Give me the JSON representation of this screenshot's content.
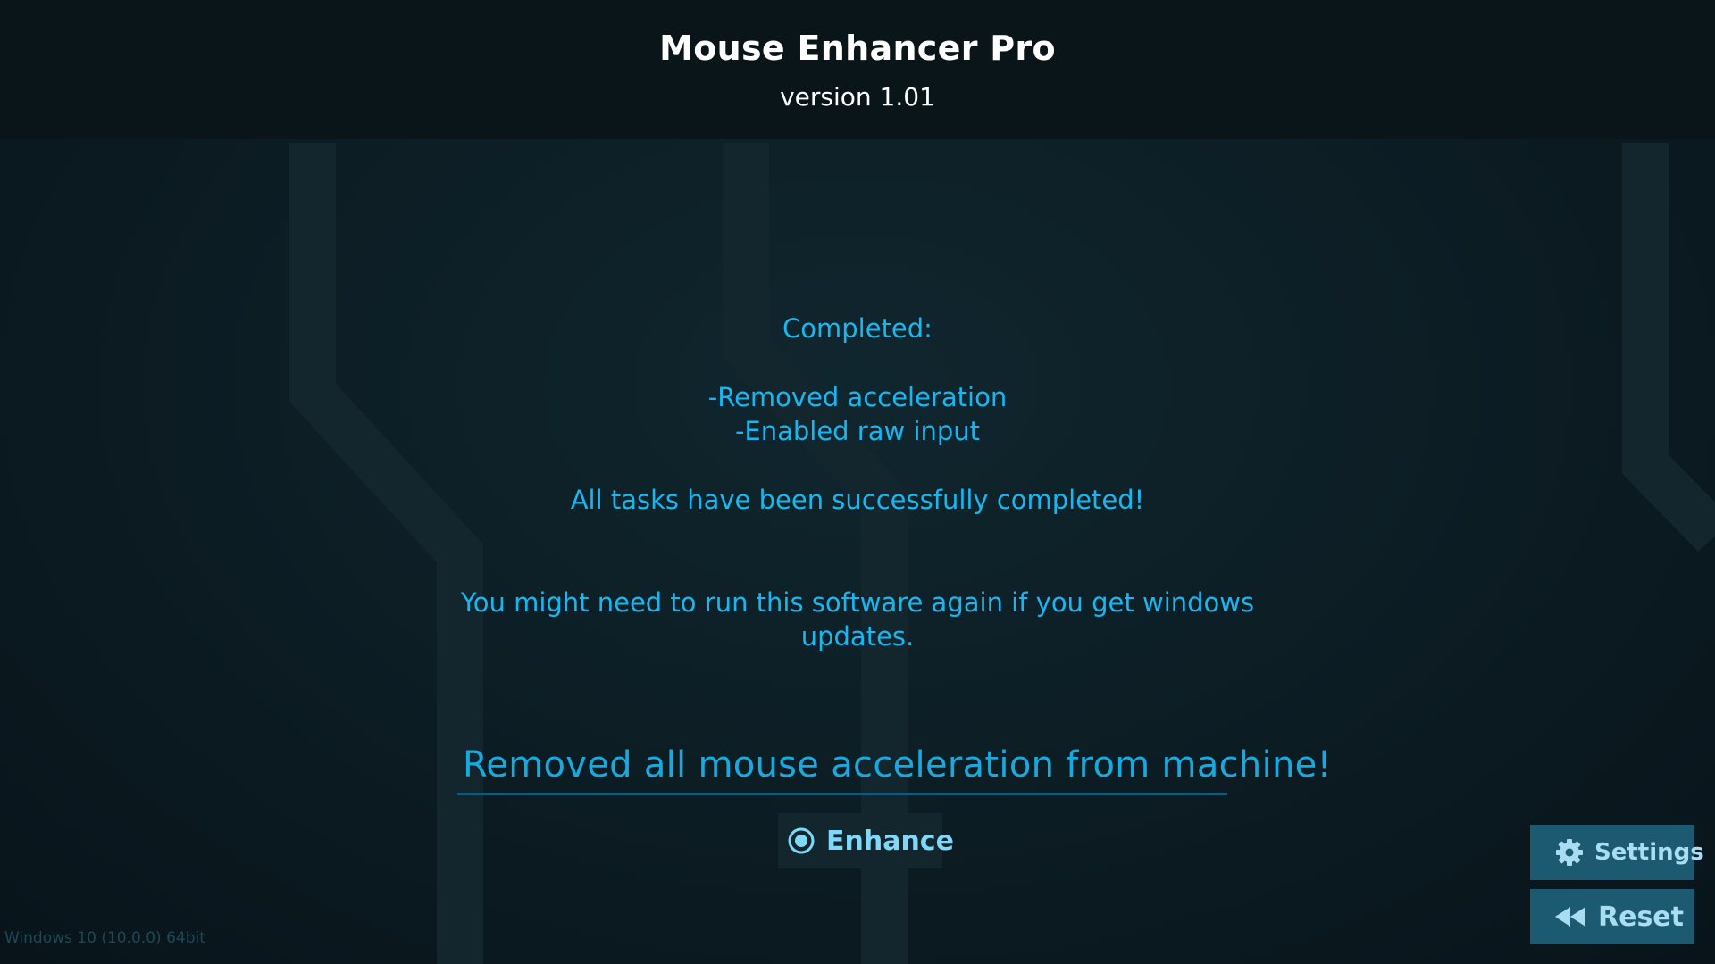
{
  "header": {
    "title": "Mouse Enhancer Pro",
    "version": "version 1.01"
  },
  "results": {
    "completed_heading": "Completed:",
    "tasks": [
      "-Removed acceleration",
      "-Enabled raw input"
    ],
    "success_message": "All tasks have been successfully completed!",
    "note_line1": "You might need to run this software again if you get windows",
    "note_line2": "updates."
  },
  "status": {
    "text": "Removed all mouse acceleration from machine!"
  },
  "actions": {
    "enhance_label": "Enhance",
    "enhance_icon": "radio-target-icon",
    "settings_label": "Settings",
    "settings_icon": "gear-icon",
    "reset_label": "Reset",
    "reset_icon": "rewind-icon"
  },
  "footer": {
    "os_info": "Windows 10  (10.0.0) 64bit"
  },
  "colors": {
    "accent": "#19b6ef",
    "button_bg": "#1c5a72",
    "header_bg": "#0a151a"
  }
}
